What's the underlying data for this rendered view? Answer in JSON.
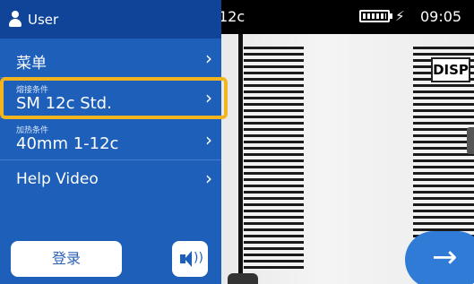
{
  "status_bar": {
    "title_fragment": "12c",
    "charging_symbol": "⚡",
    "time": "09:05",
    "battery_level": 1.0
  },
  "panel": {
    "user_label": "User",
    "items": [
      {
        "main": "菜单",
        "sub": ""
      },
      {
        "main": "SM 12c Std.",
        "sub": "熔接条件"
      },
      {
        "main": "40mm 1-12c",
        "sub": "加热条件"
      },
      {
        "main": "Help Video",
        "sub": ""
      }
    ],
    "chevron": "›",
    "highlighted_index": 1,
    "login_label": "登录",
    "sound_waves": "))"
  },
  "camera": {
    "disp_label": "DISP",
    "next_arrow": "→"
  },
  "colors": {
    "panel_bg": "#1d5fb9",
    "panel_header_bg": "#0f4499",
    "highlight": "#f3b51f",
    "next_button": "#2f7bd6"
  },
  "icons": {
    "user": "user-icon",
    "battery": "battery-icon",
    "sound": "speaker-icon",
    "next": "arrow-right-icon"
  }
}
